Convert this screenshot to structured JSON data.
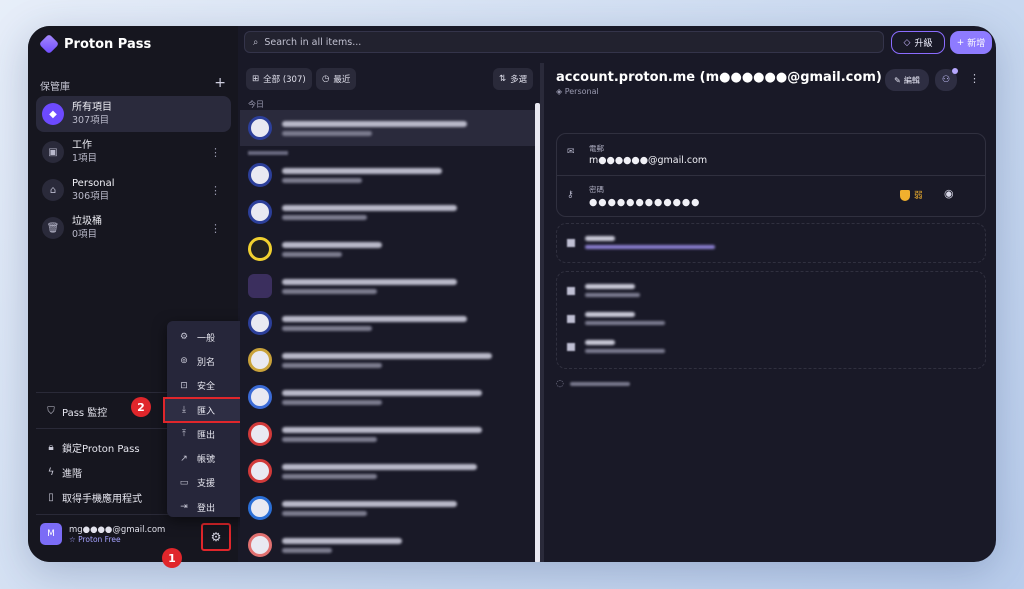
{
  "app": {
    "name": "Proton Pass"
  },
  "search": {
    "placeholder": "Search in all items..."
  },
  "header": {
    "upgrade_label": "升級",
    "new_label": "新增"
  },
  "sidebar": {
    "vaults_heading": "保管庫",
    "vaults": [
      {
        "name": "所有項目",
        "count": "307項目",
        "icon": "diamond-icon"
      },
      {
        "name": "工作",
        "count": "1項目",
        "icon": "briefcase-icon"
      },
      {
        "name": "Personal",
        "count": "306項目",
        "icon": "home-icon"
      },
      {
        "name": "垃圾桶",
        "count": "0項目",
        "icon": "trash-icon"
      }
    ],
    "monitor_label": "Pass 監控",
    "lock_label": "鎖定Proton Pass",
    "advanced_label": "進階",
    "get_app_label": "取得手機應用程式",
    "account": {
      "avatar_letter": "M",
      "email": "mg●●●●@gmail.com",
      "plan": "Proton Free"
    }
  },
  "settings_menu": {
    "items": [
      {
        "label": "一般",
        "icon": "gear-icon"
      },
      {
        "label": "別名",
        "icon": "alias-icon"
      },
      {
        "label": "安全",
        "icon": "lock-icon"
      },
      {
        "label": "匯入",
        "icon": "download-icon"
      },
      {
        "label": "匯出",
        "icon": "upload-icon"
      },
      {
        "label": "帳號",
        "icon": "external-link-icon"
      },
      {
        "label": "支援",
        "icon": "chat-icon"
      },
      {
        "label": "登出",
        "icon": "logout-icon"
      }
    ]
  },
  "annotations": {
    "step1": "1",
    "step2": "2"
  },
  "list": {
    "filter_all": "全部 (307)",
    "filter_recent": "最近",
    "multi_select": "多選",
    "section_today": "今日"
  },
  "detail": {
    "title": "account.proton.me (m●●●●●●@gmail.com)",
    "vault": "Personal",
    "edit_label": "編輯",
    "email_label": "電郵",
    "email_value": "m●●●●●●@gmail.com",
    "password_label": "密碼",
    "password_value": "●●●●●●●●●●●●",
    "weak_label": "弱"
  },
  "colors": {
    "accent": "#6d4aff",
    "highlight_red": "#e0262b",
    "warning": "#f0b02e"
  }
}
